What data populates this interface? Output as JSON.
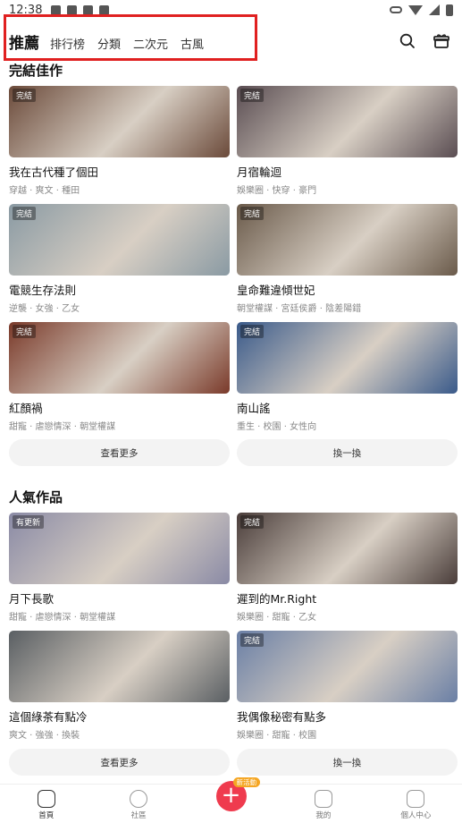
{
  "status_bar": {
    "time": "12:38"
  },
  "top_nav": {
    "tabs": [
      {
        "label": "推薦",
        "active": true
      },
      {
        "label": "排行榜",
        "active": false
      },
      {
        "label": "分類",
        "active": false
      },
      {
        "label": "二次元",
        "active": false
      },
      {
        "label": "古風",
        "active": false
      }
    ],
    "icons": [
      "search-icon",
      "gift-box-icon"
    ]
  },
  "sections": [
    {
      "title": "完結佳作",
      "cards": [
        {
          "title": "我在古代種了個田",
          "tags": "穿越 · 爽文 · 種田",
          "badge": "完結",
          "color": "#6b4a3a"
        },
        {
          "title": "月宿輪迴",
          "tags": "娛樂圈 · 快穿 · 豪門",
          "badge": "完結",
          "color": "#5a4d52"
        },
        {
          "title": "電競生存法則",
          "tags": "逆襲 · 女強 · 乙女",
          "badge": "完結",
          "color": "#8a9aa3"
        },
        {
          "title": "皇命難違傾世妃",
          "tags": "朝堂權謀 · 宮廷侯爵 · 陰差陽錯",
          "badge": "完結",
          "color": "#6a5a4a"
        },
        {
          "title": "紅顏禍",
          "tags": "甜寵 · 虐戀情深 · 朝堂權謀",
          "badge": "完結",
          "color": "#7a3a2a"
        },
        {
          "title": "南山謠",
          "tags": "重生 · 校園 · 女性向",
          "badge": "完結",
          "color": "#3a5a8a"
        }
      ],
      "buttons": [
        "查看更多",
        "換一換"
      ]
    },
    {
      "title": "人氣作品",
      "cards": [
        {
          "title": "月下長歌",
          "tags": "甜寵 · 虐戀情深 · 朝堂權謀",
          "badge": "有更新",
          "color": "#8a8aa5"
        },
        {
          "title": "遲到的Mr.Right",
          "tags": "娛樂圈 · 甜寵 · 乙女",
          "badge": "完結",
          "color": "#4a3d3a"
        },
        {
          "title": "這個綠茶有點冷",
          "tags": "爽文 · 強強 · 換裝",
          "badge": "",
          "color": "#5a5f63"
        },
        {
          "title": "我偶像秘密有點多",
          "tags": "娛樂圈 · 甜寵 · 校園",
          "badge": "完結",
          "color": "#6a7fa5"
        }
      ],
      "buttons": [
        "查看更多",
        "換一換"
      ]
    }
  ],
  "bottom_nav": {
    "items": [
      {
        "label": "首頁",
        "icon": "home-icon",
        "active": true
      },
      {
        "label": "社區",
        "icon": "community-icon",
        "active": false
      },
      {
        "label": "",
        "icon": "plus-icon",
        "active": false
      },
      {
        "label": "我的",
        "icon": "bookshelf-icon",
        "active": false
      },
      {
        "label": "個人中心",
        "icon": "profile-icon",
        "active": false
      }
    ],
    "plus_badge": "新活動"
  }
}
